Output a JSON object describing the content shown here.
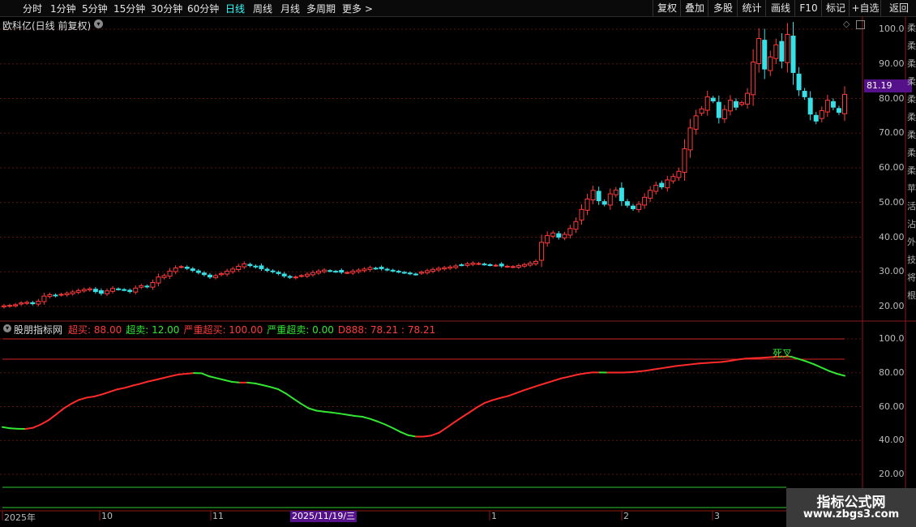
{
  "toolbar": {
    "timeframes": [
      "分时",
      "1分钟",
      "5分钟",
      "15分钟",
      "30分钟",
      "60分钟",
      "日线",
      "周线",
      "月线",
      "多周期",
      "更多 >"
    ],
    "active_timeframe": "日线",
    "buttons": [
      "复权",
      "叠加",
      "多股",
      "统计",
      "画线",
      "F10",
      "标记",
      "+自选",
      "返回"
    ]
  },
  "main_chart": {
    "title": "欧科亿(日线 前复权)",
    "price_tag": "81.19",
    "y_ticks": [
      "100.0",
      "90.00",
      "80.00",
      "70.00",
      "60.00",
      "50.00",
      "40.00",
      "30.00",
      "20.00"
    ]
  },
  "indicator": {
    "name": "股朋指标网",
    "params": [
      {
        "label": "超买: 88.00",
        "color": "#ff3b3b"
      },
      {
        "label": "超卖: 12.00",
        "color": "#33e633"
      },
      {
        "label": "严重超买: 100.00",
        "color": "#ff3b3b"
      },
      {
        "label": "严重超卖: 0.00",
        "color": "#33e633"
      },
      {
        "label": "D888: 78.21 : 78.21",
        "color": "#ff3b3b"
      }
    ],
    "annotation": "死叉",
    "y_ticks": [
      "100.0",
      "80.00",
      "60.00",
      "40.00",
      "20.00"
    ]
  },
  "x_axis": {
    "labels": [
      "2025年",
      "10",
      "11",
      "1",
      "2",
      "3"
    ],
    "cursor_date": "2025/11/19/三"
  },
  "side_panel_chars": [
    "柔",
    "柔",
    "柔",
    "柔",
    "柔",
    "柔",
    "柔",
    "柔",
    "柔",
    "苹",
    "活",
    "沾",
    "外",
    "技",
    "将",
    "根"
  ],
  "watermark": {
    "line1": "指标公式网",
    "line2": "www.zbgs3.com"
  },
  "chart_data": {
    "type": "candlestick",
    "ylim": [
      16,
      102
    ],
    "closes": [
      20.2,
      20.3,
      20.5,
      21,
      21.2,
      20.8,
      21.5,
      23,
      23.4,
      23.1,
      23.5,
      23.8,
      24.2,
      24.6,
      24.9,
      25.1,
      24.3,
      23.8,
      24.5,
      25.2,
      25,
      24.8,
      24.3,
      25.3,
      26,
      25.7,
      26.9,
      28.5,
      28.9,
      30.2,
      31.1,
      31.5,
      31,
      30.4,
      29.8,
      29.2,
      28.5,
      28.9,
      29.5,
      30.2,
      30.8,
      31.6,
      32.3,
      31.8,
      31.4,
      30.9,
      30.4,
      30,
      29.5,
      28.8,
      28.4,
      28.5,
      28.9,
      29.3,
      29.8,
      30.2,
      30.5,
      30.3,
      30.1,
      29.9,
      29.8,
      30.2,
      30.5,
      30.8,
      31.2,
      31,
      30.9,
      30.6,
      30.3,
      30,
      29.8,
      29.5,
      29.3,
      29.9,
      30.3,
      30.7,
      31,
      31.2,
      31.4,
      31.7,
      32,
      32.3,
      32.5,
      32.4,
      32.2,
      32,
      31.9,
      31.7,
      31.6,
      31.5,
      31.8,
      32.1,
      32.5,
      33,
      38.5,
      40.5,
      41.2,
      40,
      40.8,
      42.5,
      44.5,
      48,
      51,
      53.5,
      50.5,
      49.5,
      52.5,
      53.6,
      50.5,
      49.2,
      48.2,
      49.5,
      51.5,
      53.5,
      55,
      54.5,
      56.5,
      57.5,
      59,
      65.5,
      71.5,
      75,
      77,
      80.5,
      79.3,
      74.5,
      76.8,
      79.5,
      77.5,
      78.8,
      81.5,
      90.5,
      97.3,
      88.5,
      92,
      95.5,
      90.8,
      98.5,
      87.5,
      82.5,
      80.5,
      75.5,
      73.5,
      76.5,
      79.5,
      77.5,
      76,
      81.19
    ],
    "indicator_series": [
      {
        "name": "D888",
        "values": [
          47.9,
          47.2,
          46.9,
          46.8,
          47.5,
          49.4,
          51.9,
          55.3,
          58.9,
          61.7,
          64,
          65.3,
          66,
          67.2,
          68.7,
          70.2,
          71.1,
          72.4,
          73.5,
          74.8,
          75.8,
          76.9,
          78,
          79,
          79.4,
          79.8,
          79.7,
          77.9,
          76.8,
          75.7,
          74.6,
          74.2,
          74.2,
          73.7,
          72.7,
          71.6,
          70.3,
          67.8,
          64.7,
          61.7,
          59,
          57.6,
          57,
          56.5,
          55.9,
          55.2,
          54.5,
          54,
          52.8,
          51.2,
          49.4,
          47.3,
          45,
          43.1,
          42.3,
          42.3,
          42.9,
          44.5,
          47.5,
          50.7,
          53.7,
          56.6,
          59.6,
          62.2,
          63.8,
          65.1,
          66.2,
          67.8,
          69.5,
          71,
          72.5,
          73.9,
          75.3,
          76.7,
          77.7,
          78.8,
          79.6,
          80.2,
          80.2,
          80.1,
          80.1,
          80.1,
          80.3,
          80.7,
          81.2,
          81.9,
          82.6,
          83.3,
          84,
          84.5,
          85,
          85.5,
          85.8,
          86.1,
          86.4,
          87,
          87.8,
          88.3,
          88.6,
          88.8,
          89.1,
          89.4,
          89.5,
          89.5,
          88.1,
          86.7,
          85,
          83,
          81,
          79.4,
          78.21
        ]
      }
    ],
    "levels": [
      {
        "name": "超买",
        "value": 88
      },
      {
        "name": "超卖",
        "value": 12
      },
      {
        "name": "严重超买",
        "value": 100
      },
      {
        "name": "严重超卖",
        "value": 0
      }
    ]
  }
}
